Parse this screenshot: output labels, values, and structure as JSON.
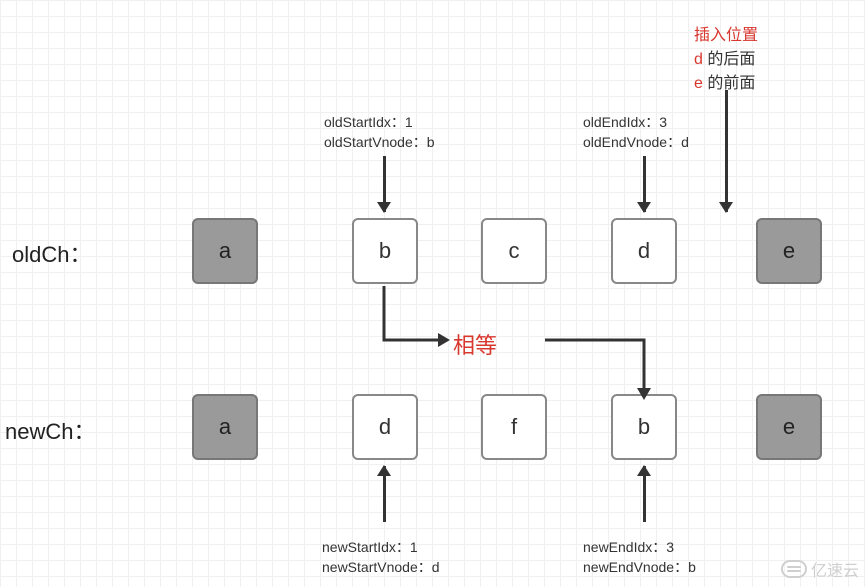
{
  "annotation": {
    "line1": "插入位置",
    "line2a": "d",
    "line2b": " 的后面",
    "line3a": "e",
    "line3b": " 的前面"
  },
  "oldStart": {
    "idx_label": "oldStartIdx：1",
    "vnode_label": "oldStartVnode：b"
  },
  "oldEnd": {
    "idx_label": "oldEndIdx：3",
    "vnode_label": "oldEndVnode：d"
  },
  "newStart": {
    "idx_label": "newStartIdx：1",
    "vnode_label": "newStartVnode：d"
  },
  "newEnd": {
    "idx_label": "newEndIdx：3",
    "vnode_label": "newEndVnode：b"
  },
  "rows": {
    "old_label": "oldCh：",
    "new_label": "newCh："
  },
  "nodes": {
    "old": {
      "n0": "a",
      "n1": "b",
      "n2": "c",
      "n3": "d",
      "n4": "e"
    },
    "new": {
      "n0": "a",
      "n1": "d",
      "n2": "f",
      "n3": "b",
      "n4": "e"
    }
  },
  "equal_label": "相等",
  "watermark": "亿速云",
  "chart_data": {
    "type": "diagram",
    "rows": [
      {
        "name": "oldCh",
        "items": [
          "a",
          "b",
          "c",
          "d",
          "e"
        ],
        "inactive": [
          0,
          4
        ]
      },
      {
        "name": "newCh",
        "items": [
          "a",
          "d",
          "f",
          "b",
          "e"
        ],
        "inactive": [
          0,
          4
        ]
      }
    ],
    "pointers": {
      "oldStartIdx": 1,
      "oldStartVnode": "b",
      "oldEndIdx": 3,
      "oldEndVnode": "d",
      "newStartIdx": 1,
      "newStartVnode": "d",
      "newEndIdx": 3,
      "newEndVnode": "b"
    },
    "match": {
      "from": "oldCh[1]",
      "to": "newCh[3]",
      "label": "相等"
    },
    "insert_note": "插入位置 d 的后面 e 的前面"
  }
}
